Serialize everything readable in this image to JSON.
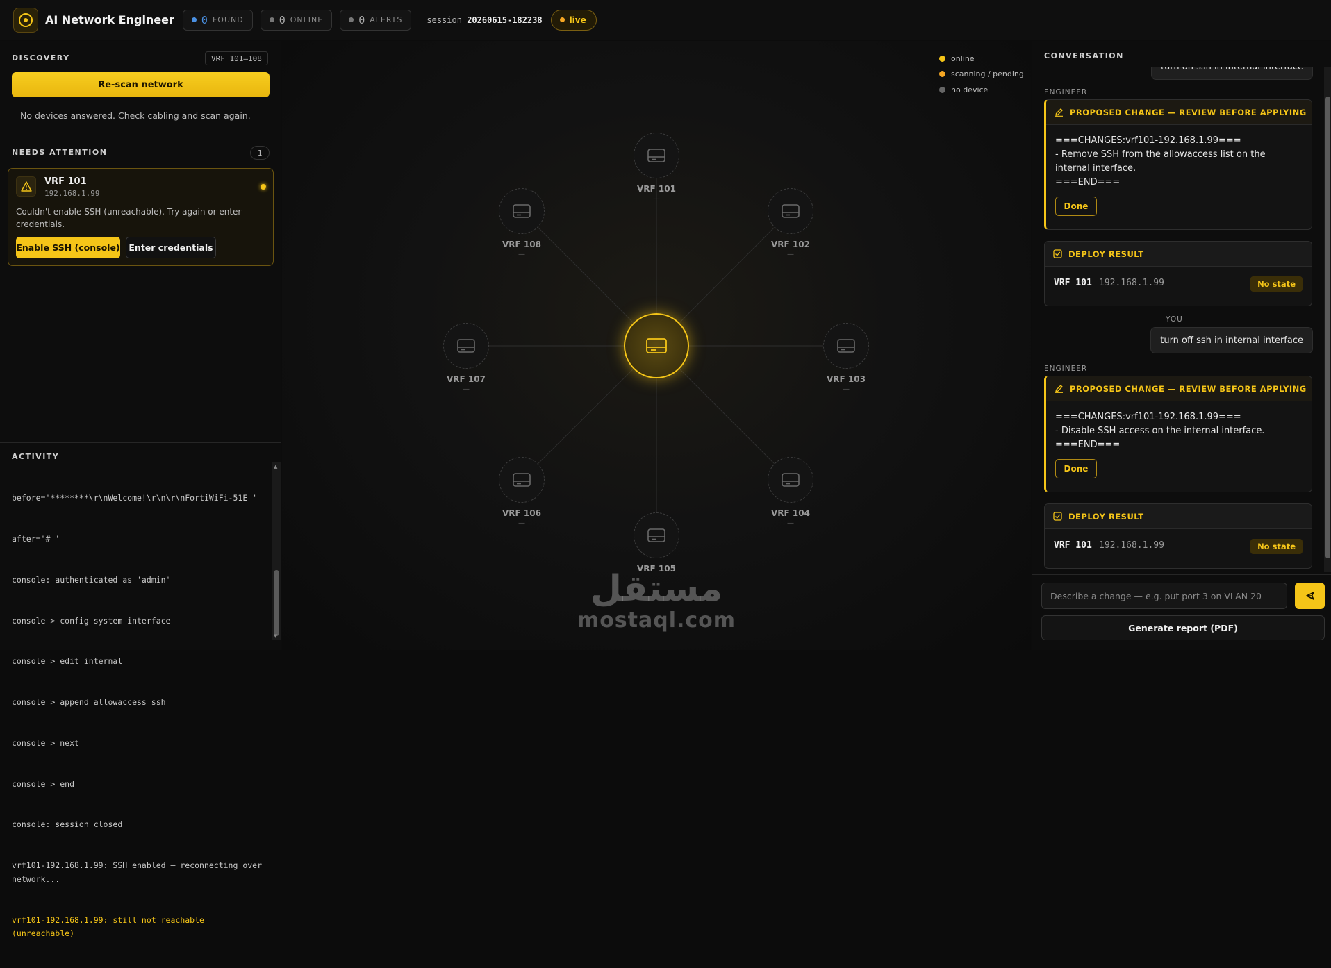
{
  "header": {
    "app_title": "AI Network Engineer",
    "found": {
      "count": "0",
      "label": "FOUND",
      "color": "#4a90e2"
    },
    "online": {
      "count": "0",
      "label": "ONLINE",
      "color": "#777777"
    },
    "alerts": {
      "count": "0",
      "label": "ALERTS",
      "color": "#777777"
    },
    "session_label": "session",
    "session_id": "20260615-182238",
    "live_label": "live"
  },
  "discovery": {
    "title": "DISCOVERY",
    "vrf_range": "VRF 101–108",
    "rescan_label": "Re-scan network",
    "status_text": "No devices answered. Check cabling and scan again."
  },
  "attention": {
    "title": "NEEDS ATTENTION",
    "count": "1",
    "card": {
      "name": "VRF 101",
      "ip": "192.168.1.99",
      "message": "Couldn't enable SSH (unreachable). Try again or enter credentials.",
      "primary_action": "Enable SSH (console)",
      "secondary_action": "Enter credentials"
    }
  },
  "activity": {
    "title": "ACTIVITY",
    "lines": [
      "before='********\\r\\nWelcome!\\r\\n\\r\\nFortiWiFi-51E '",
      "after='# '",
      "console: authenticated as 'admin'",
      "console > config system interface",
      "console > edit internal",
      "console > append allowaccess ssh",
      "console > next",
      "console > end",
      "console: session closed",
      "vrf101-192.168.1.99: SSH enabled — reconnecting over network..."
    ],
    "warning_line": "vrf101-192.168.1.99: still not reachable (unreachable)"
  },
  "topology": {
    "legend": [
      {
        "label": "online",
        "color": "#f5c518"
      },
      {
        "label": "scanning / pending",
        "color": "#f5a623"
      },
      {
        "label": "no device",
        "color": "#666666"
      }
    ],
    "nodes": [
      {
        "name": "VRF 101",
        "sub": "—"
      },
      {
        "name": "VRF 102",
        "sub": "—"
      },
      {
        "name": "VRF 103",
        "sub": "—"
      },
      {
        "name": "VRF 104",
        "sub": "—"
      },
      {
        "name": "VRF 105",
        "sub": "—"
      },
      {
        "name": "VRF 106",
        "sub": "—"
      },
      {
        "name": "VRF 107",
        "sub": "—"
      },
      {
        "name": "VRF 108",
        "sub": "—"
      }
    ],
    "watermark_ar": "مستقل",
    "watermark_en": "mostaql.com"
  },
  "conversation": {
    "title": "CONVERSATION",
    "top_you_message": "turn on ssh in internal interface",
    "engineer_label": "ENGINEER",
    "you_label": "YOU",
    "proposal_title": "PROPOSED CHANGE — REVIEW BEFORE APPLYING",
    "deploy_title": "DEPLOY RESULT",
    "done_label": "Done",
    "proposal1": {
      "line1": "===CHANGES:vrf101-192.168.1.99===",
      "line2": "- Remove SSH from the allowaccess list on the internal interface.",
      "line3": "===END==="
    },
    "deploy1": {
      "device": "VRF 101",
      "ip": "192.168.1.99",
      "state": "No state"
    },
    "you_message": "turn off ssh in internal interface",
    "proposal2": {
      "line1": "===CHANGES:vrf101-192.168.1.99===",
      "line2": "- Disable SSH access on the internal interface.",
      "line3": "===END==="
    },
    "deploy2": {
      "device": "VRF 101",
      "ip": "192.168.1.99",
      "state": "No state"
    },
    "input_placeholder": "Describe a change — e.g. put port 3 on VLAN 20",
    "report_label": "Generate report (PDF)"
  }
}
